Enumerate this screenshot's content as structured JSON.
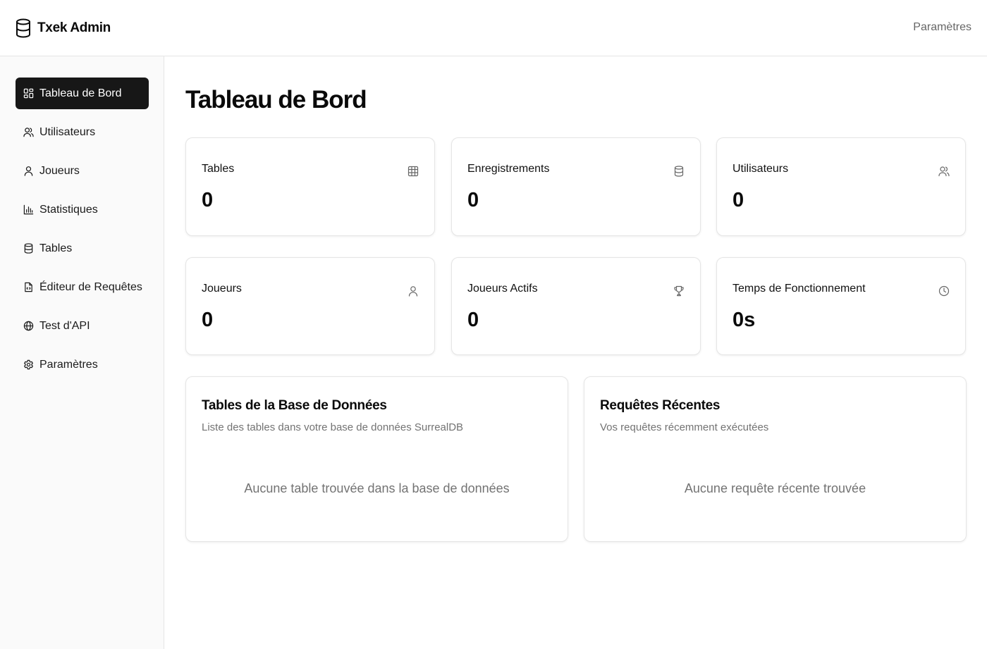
{
  "header": {
    "brand": "Txek Admin",
    "settings_link": "Paramètres"
  },
  "sidebar": {
    "items": [
      {
        "label": "Tableau de Bord",
        "icon": "dashboard-icon",
        "active": true
      },
      {
        "label": "Utilisateurs",
        "icon": "users-icon"
      },
      {
        "label": "Joueurs",
        "icon": "user-icon"
      },
      {
        "label": "Statistiques",
        "icon": "bar-chart-icon"
      },
      {
        "label": "Tables",
        "icon": "database-icon"
      },
      {
        "label": "Éditeur de Requêtes",
        "icon": "file-code-icon"
      },
      {
        "label": "Test d'API",
        "icon": "globe-icon"
      },
      {
        "label": "Paramètres",
        "icon": "gear-icon"
      }
    ]
  },
  "main": {
    "title": "Tableau de Bord",
    "stats": [
      {
        "label": "Tables",
        "value": "0",
        "icon": "table-icon"
      },
      {
        "label": "Enregistrements",
        "value": "0",
        "icon": "database-icon"
      },
      {
        "label": "Utilisateurs",
        "value": "0",
        "icon": "users-icon"
      },
      {
        "label": "Joueurs",
        "value": "0",
        "icon": "user-icon"
      },
      {
        "label": "Joueurs Actifs",
        "value": "0",
        "icon": "trophy-icon"
      },
      {
        "label": "Temps de Fonctionnement",
        "value": "0s",
        "icon": "clock-icon"
      }
    ],
    "tables_panel": {
      "title": "Tables de la Base de Données",
      "subtitle": "Liste des tables dans votre base de données SurrealDB",
      "empty": "Aucune table trouvée dans la base de données"
    },
    "queries_panel": {
      "title": "Requêtes Récentes",
      "subtitle": "Vos requêtes récemment exécutées",
      "empty": "Aucune requête récente trouvée"
    }
  }
}
